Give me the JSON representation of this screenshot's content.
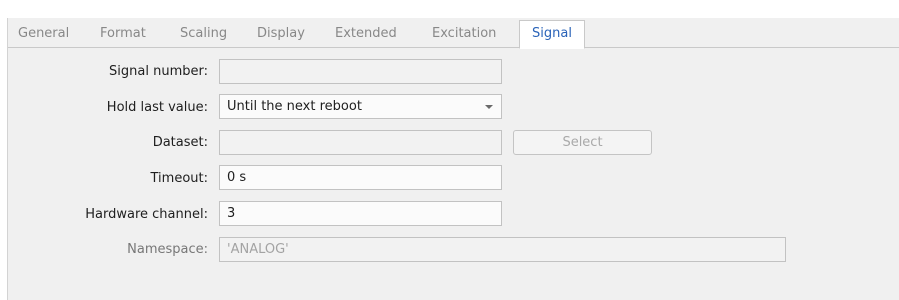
{
  "tabs": [
    {
      "label": "General"
    },
    {
      "label": "Format"
    },
    {
      "label": "Scaling"
    },
    {
      "label": "Display"
    },
    {
      "label": "Extended"
    },
    {
      "label": "Excitation"
    },
    {
      "label": "Signal",
      "active": true
    }
  ],
  "form": {
    "signal_number": {
      "label": "Signal number:",
      "value": ""
    },
    "hold_last_value": {
      "label": "Hold last value:",
      "value": "Until the next reboot"
    },
    "dataset": {
      "label": "Dataset:",
      "value": "",
      "button": "Select"
    },
    "timeout": {
      "label": "Timeout:",
      "value": "0 s"
    },
    "hardware_channel": {
      "label": "Hardware channel:",
      "value": "3"
    },
    "namespace": {
      "label": "Namespace:",
      "value": "'ANALOG'"
    }
  },
  "icons": {
    "dropdown": "chevron-down-icon"
  },
  "colors": {
    "active_tab_text": "#2a63b8",
    "panel_bg": "#f0f0f0"
  }
}
